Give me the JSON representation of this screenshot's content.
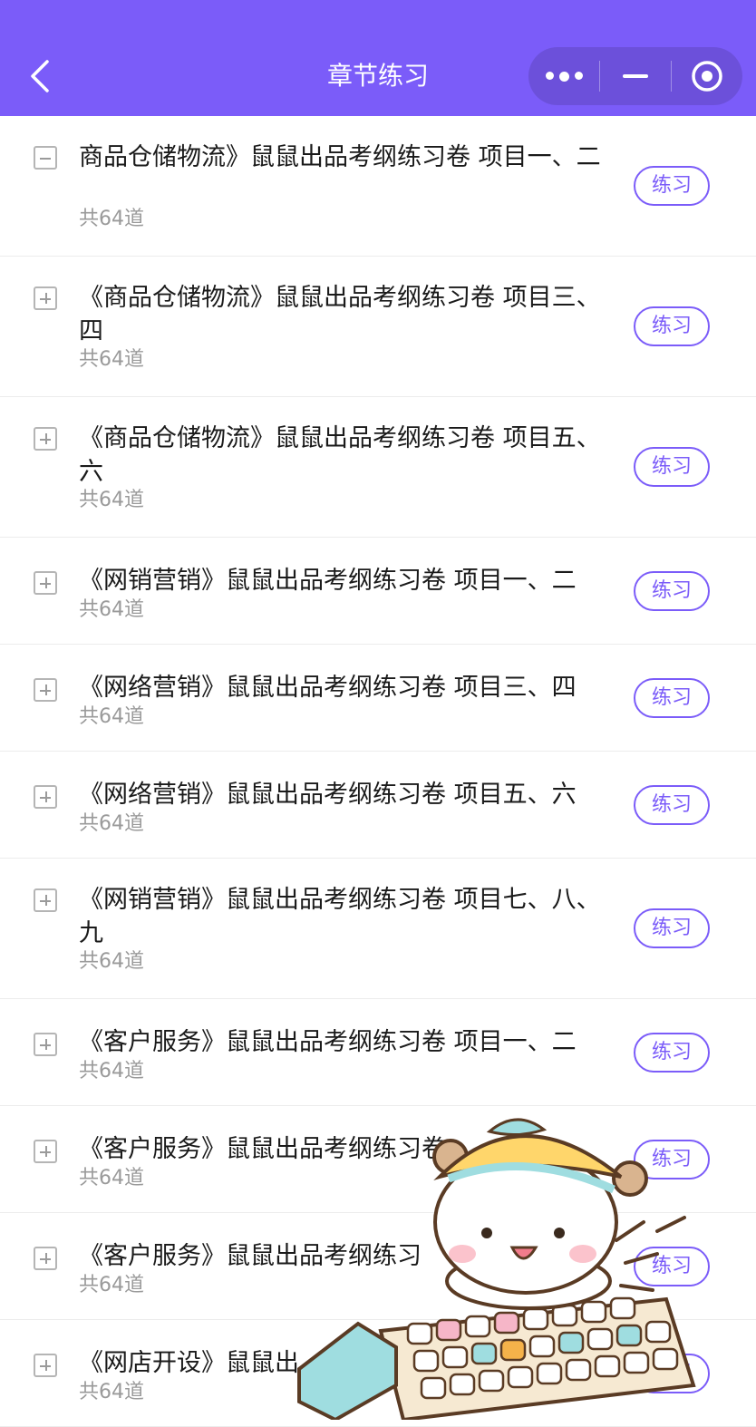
{
  "header": {
    "title": "章节练习"
  },
  "chapters": [
    {
      "title": "商品仓储物流》鼠鼠出品考纲练习卷 项目一、二",
      "count": "共64道",
      "action": "练习"
    },
    {
      "title": "《商品仓储物流》鼠鼠出品考纲练习卷 项目三、四",
      "count": "共64道",
      "action": "练习"
    },
    {
      "title": "《商品仓储物流》鼠鼠出品考纲练习卷 项目五、六",
      "count": "共64道",
      "action": "练习"
    },
    {
      "title": "《网销营销》鼠鼠出品考纲练习卷 项目一、二",
      "count": "共64道",
      "action": "练习"
    },
    {
      "title": "《网络营销》鼠鼠出品考纲练习卷 项目三、四",
      "count": "共64道",
      "action": "练习"
    },
    {
      "title": "《网络营销》鼠鼠出品考纲练习卷 项目五、六",
      "count": "共64道",
      "action": "练习"
    },
    {
      "title": "《网销营销》鼠鼠出品考纲练习卷 项目七、八、九",
      "count": "共64道",
      "action": "练习"
    },
    {
      "title": "《客户服务》鼠鼠出品考纲练习卷 项目一、二",
      "count": "共64道",
      "action": "练习"
    },
    {
      "title": "《客户服务》鼠鼠出品考纲练习卷",
      "count": "共64道",
      "action": "练习"
    },
    {
      "title": "《客户服务》鼠鼠出品考纲练习",
      "count": "共64道",
      "action": "练习"
    },
    {
      "title": "《网店开设》鼠鼠出",
      "count": "共64道",
      "action": "练习"
    }
  ]
}
